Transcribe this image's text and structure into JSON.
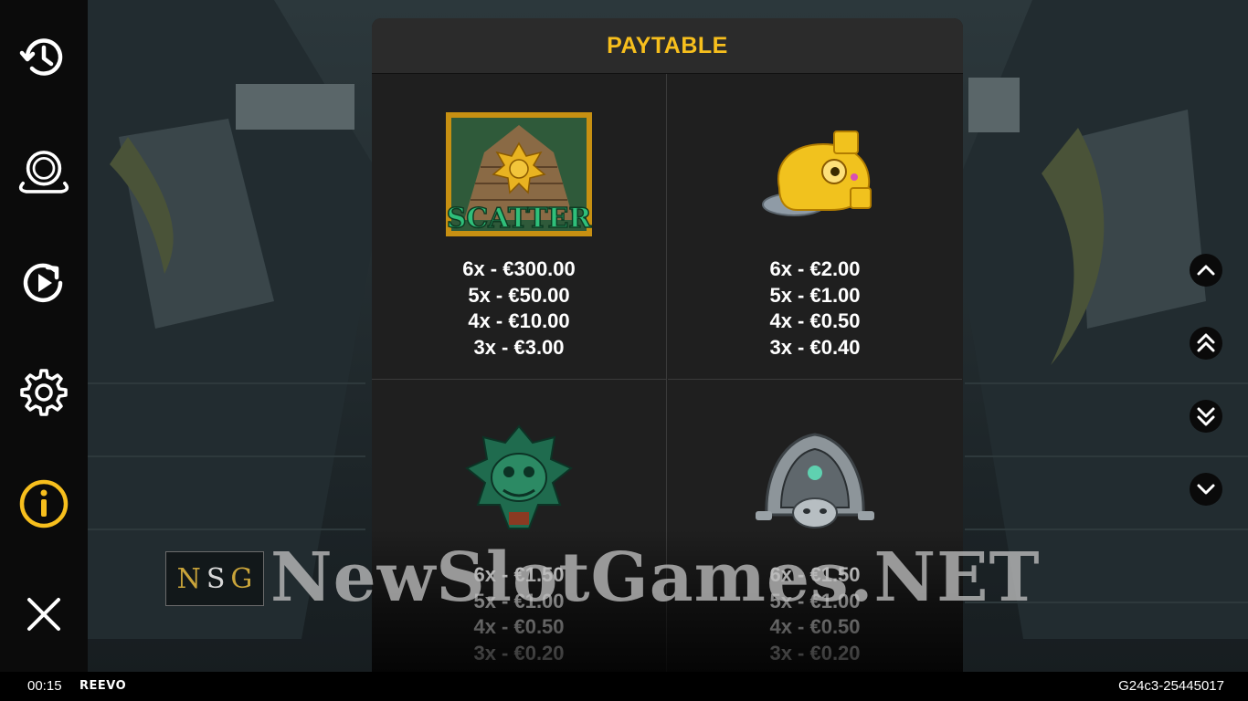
{
  "panel": {
    "title": "PAYTABLE",
    "symbols": [
      {
        "name": "scatter",
        "symbol_text": "SCATTER",
        "pays": [
          "6x - €300.00",
          "5x - €50.00",
          "4x - €10.00",
          "3x - €3.00"
        ]
      },
      {
        "name": "gold-frog",
        "pays": [
          "6x - €2.00",
          "5x - €1.00",
          "4x - €0.50",
          "3x - €0.40"
        ]
      },
      {
        "name": "jade-mask",
        "pays": [
          "6x - €1.50",
          "5x - €1.00",
          "4x - €0.50",
          "3x - €0.20"
        ]
      },
      {
        "name": "silver-mask",
        "pays": [
          "6x - €1.50",
          "5x - €1.00",
          "4x - €0.50",
          "3x - €0.20"
        ]
      }
    ]
  },
  "sidebar": {
    "items": [
      {
        "icon": "history-icon"
      },
      {
        "icon": "coin-stack-icon"
      },
      {
        "icon": "autoplay-icon"
      },
      {
        "icon": "settings-gear-icon"
      },
      {
        "icon": "info-icon",
        "active": true
      },
      {
        "icon": "close-icon"
      }
    ]
  },
  "scroll_buttons": [
    {
      "icon": "chevron-up-icon"
    },
    {
      "icon": "double-chevron-up-icon"
    },
    {
      "icon": "double-chevron-down-icon"
    },
    {
      "icon": "chevron-down-icon"
    }
  ],
  "bottom_bar": {
    "clock": "00:15",
    "brand": "REEVO",
    "session_id": "G24c3-25445017"
  },
  "watermark": {
    "logo_letters": [
      "N",
      "S",
      "G"
    ],
    "text": "NewSlotGames.NET"
  },
  "colors": {
    "accent": "#f7bf1d",
    "panel": "#1f1f1f",
    "header": "#2b2b2b",
    "sidebar": "#0b0b0b"
  }
}
